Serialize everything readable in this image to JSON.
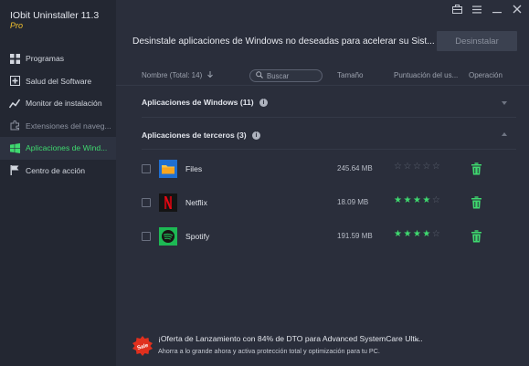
{
  "app": {
    "title": "IObit Uninstaller 11.3",
    "edition": "Pro"
  },
  "sidebar": {
    "items": [
      {
        "label": "Programas",
        "icon": "grid-icon",
        "selected": false
      },
      {
        "label": "Salud del Software",
        "icon": "health-plus-icon",
        "selected": false
      },
      {
        "label": "Monitor de instalación",
        "icon": "line-chart-icon",
        "selected": false
      },
      {
        "label": "Extensiones del naveg...",
        "icon": "puzzle-icon",
        "selected": false
      },
      {
        "label": "Aplicaciones de Wind...",
        "icon": "windows-logo-icon",
        "selected": true
      },
      {
        "label": "Centro de acción",
        "icon": "flag-icon",
        "selected": false
      }
    ]
  },
  "main": {
    "headline": "Desinstale aplicaciones de Windows no deseadas para acelerar su Sist...",
    "uninstall_label": "Desinstalar",
    "columns": {
      "name": "Nombre (Total: 14)",
      "size": "Tamaño",
      "rating": "Puntuación del us...",
      "operation": "Operación"
    },
    "search": {
      "placeholder": "Buscar"
    },
    "sections": [
      {
        "title": "Aplicaciones de Windows (11)",
        "expanded": false
      },
      {
        "title": "Aplicaciones de terceros (3)",
        "expanded": true
      }
    ],
    "apps": [
      {
        "name": "Files",
        "size": "245.64 MB",
        "stars": 0,
        "icon": "files-folder-icon"
      },
      {
        "name": "Netflix",
        "size": "18.09 MB",
        "stars": 4,
        "icon": "netflix-logo-icon"
      },
      {
        "name": "Spotify",
        "size": "191.59 MB",
        "stars": 4,
        "icon": "spotify-logo-icon"
      }
    ]
  },
  "promo": {
    "badge": "Sale",
    "line1": "¡Oferta de Lanzamiento con 84% de DTO para Advanced SystemCare Ulti...",
    "line2": "Ahorra a lo grande ahora y activa protección total y optimización para tu PC.",
    "close": "×"
  },
  "colors": {
    "accent_green": "#3fd96f",
    "sidebar_bg": "#232732",
    "main_bg": "#2a2e3b",
    "star_off": "#5d6371",
    "edition_yellow": "#f2c12e"
  }
}
